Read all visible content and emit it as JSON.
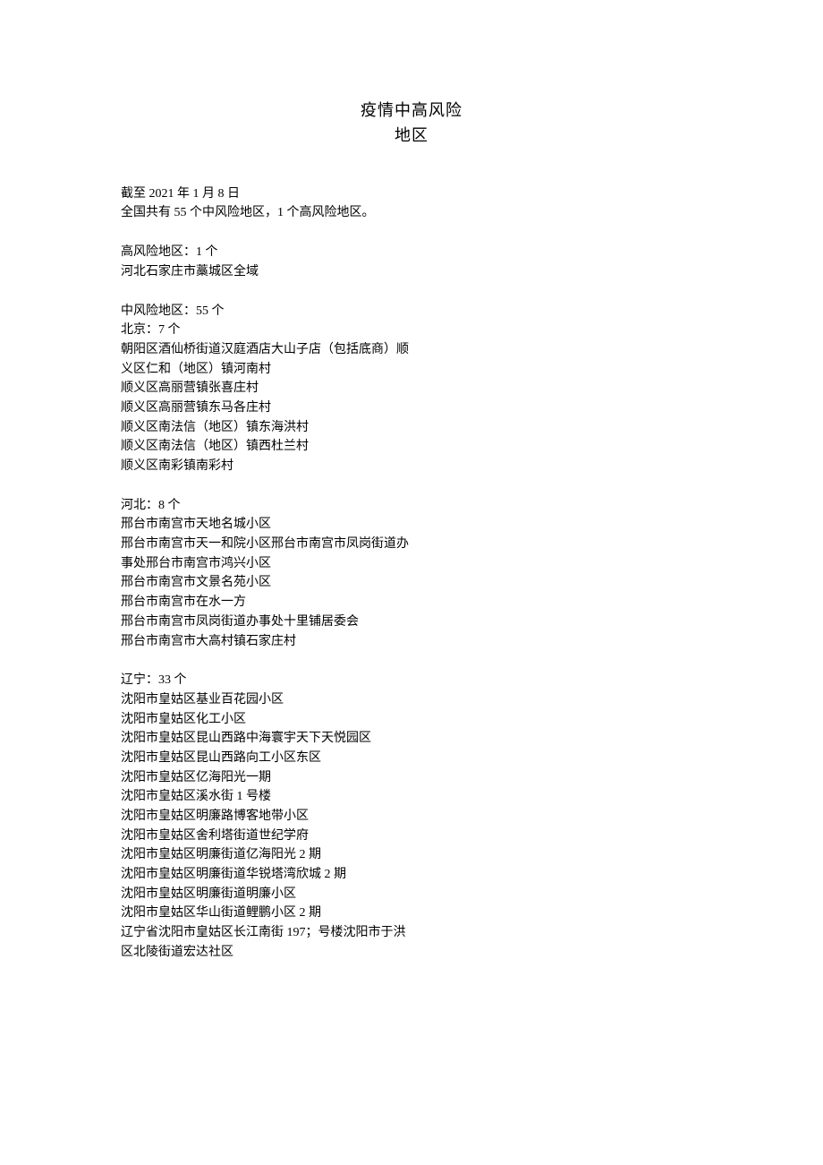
{
  "title": {
    "line1": "疫情中高风险",
    "line2": "地区"
  },
  "intro": {
    "l1": "截至 2021 年 1 月 8 日",
    "l2": "全国共有 55 个中风险地区，1 个高风险地区。"
  },
  "high": {
    "header": "高风险地区：1 个",
    "l1": "河北石家庄市藁城区全域"
  },
  "medium_header": "中风险地区：55 个",
  "beijing": {
    "header": "北京：7 个",
    "l1": "朝阳区酒仙桥街道汉庭酒店大山子店（包括底商）顺",
    "l2": "义区仁和（地区）镇河南村",
    "l3": "顺义区高丽营镇张喜庄村",
    "l4": "顺义区高丽营镇东马各庄村",
    "l5": "顺义区南法信（地区）镇东海洪村",
    "l6": "顺义区南法信（地区）镇西杜兰村",
    "l7": "顺义区南彩镇南彩村"
  },
  "hebei": {
    "header": "河北：8 个",
    "l1": "邢台市南宫市天地名城小区",
    "l2": "邢台市南宫市天一和院小区邢台市南宫市凤岗街道办",
    "l3": "事处邢台市南宫市鸿兴小区",
    "l4": "邢台市南宫市文景名苑小区",
    "l5": "邢台市南宫市在水一方",
    "l6": "邢台市南宫市凤岗街道办事处十里铺居委会",
    "l7": "邢台市南宫市大高村镇石家庄村"
  },
  "liaoning": {
    "header": "辽宁：33 个",
    "l1": "沈阳市皇姑区基业百花园小区",
    "l2": "沈阳市皇姑区化工小区",
    "l3": "沈阳市皇姑区昆山西路中海寰宇天下天悦园区",
    "l4": "沈阳市皇姑区昆山西路向工小区东区",
    "l5": "沈阳市皇姑区亿海阳光一期",
    "l6": "沈阳市皇姑区溪水街 1 号楼",
    "l7": "沈阳市皇姑区明廉路博客地带小区",
    "l8": "沈阳市皇姑区舍利塔街道世纪学府",
    "l9": "沈阳市皇姑区明廉街道亿海阳光 2 期",
    "l10": "沈阳市皇姑区明廉街道华锐塔湾欣城 2 期",
    "l11": "沈阳市皇姑区明廉街道明廉小区",
    "l12": "沈阳市皇姑区华山街道鲤鹏小区 2 期",
    "l13": "辽宁省沈阳市皇姑区长江南街 197；号楼沈阳市于洪",
    "l14": "区北陵街道宏达社区"
  }
}
